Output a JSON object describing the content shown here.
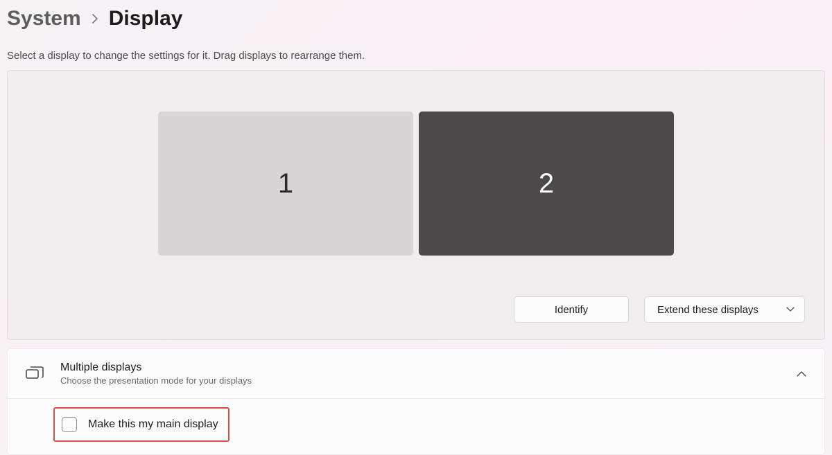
{
  "breadcrumb": {
    "parent": "System",
    "current": "Display"
  },
  "instruction": "Select a display to change the settings for it. Drag displays to rearrange them.",
  "monitors": [
    {
      "label": "1",
      "selected": false
    },
    {
      "label": "2",
      "selected": true
    }
  ],
  "buttons": {
    "identify": "Identify",
    "extend_mode": "Extend these displays"
  },
  "multiple_displays": {
    "title": "Multiple displays",
    "subtitle": "Choose the presentation mode for your displays",
    "expanded": true,
    "main_display_label": "Make this my main display",
    "main_display_checked": false
  }
}
